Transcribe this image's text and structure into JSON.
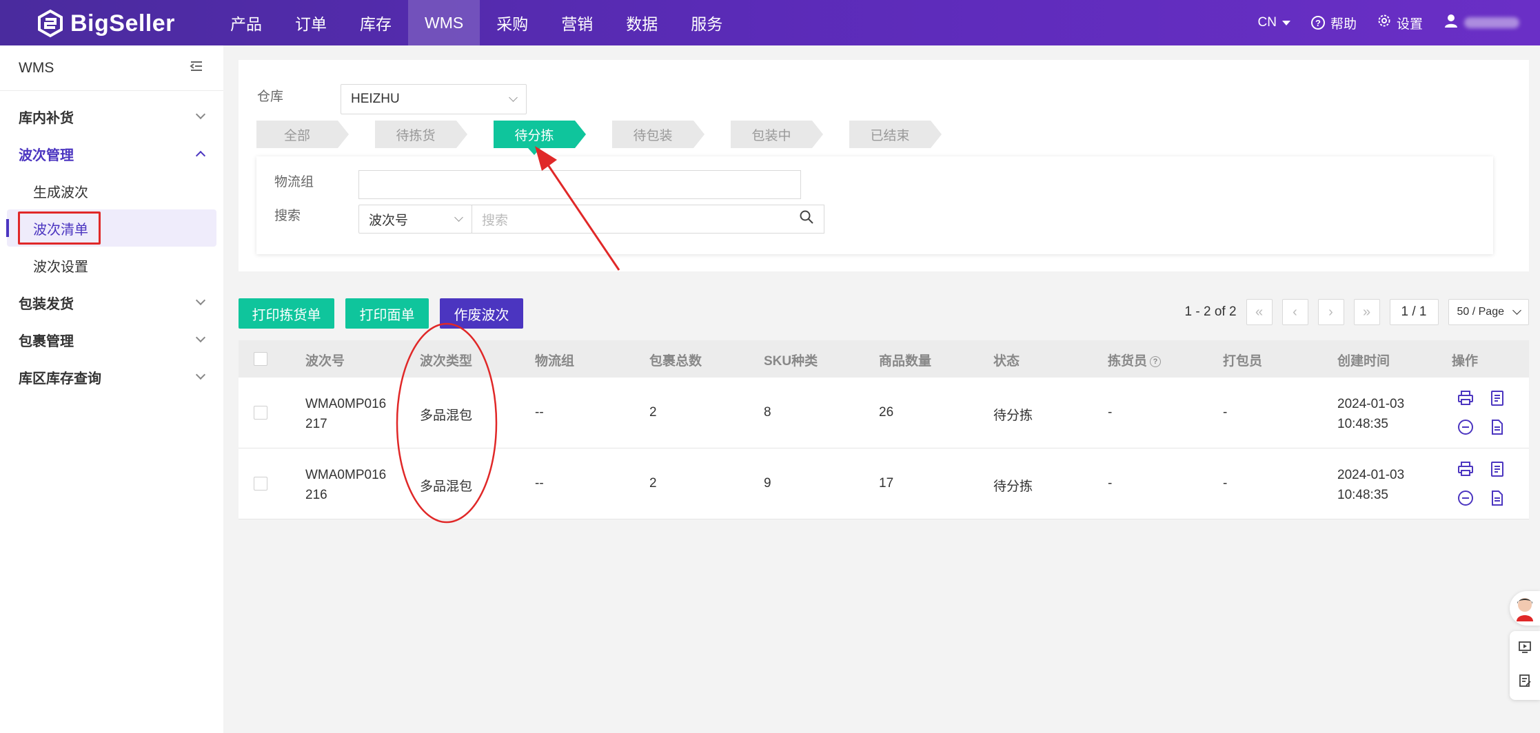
{
  "brand": {
    "name": "BigSeller"
  },
  "nav": {
    "items": [
      "产品",
      "订单",
      "库存",
      "WMS",
      "采购",
      "营销",
      "数据",
      "服务"
    ],
    "active": "WMS"
  },
  "topright": {
    "lang": "CN",
    "help": "帮助",
    "settings": "设置"
  },
  "sidebar": {
    "title": "WMS",
    "groups": [
      {
        "label": "库内补货"
      },
      {
        "label": "波次管理",
        "subs": [
          "生成波次",
          "波次清单",
          "波次设置"
        ]
      },
      {
        "label": "包装发货"
      },
      {
        "label": "包裹管理"
      },
      {
        "label": "库区库存查询"
      }
    ]
  },
  "filter": {
    "warehouse_label": "仓库",
    "warehouse_value": "HEIZHU",
    "steps": [
      "全部",
      "待拣货",
      "待分拣",
      "待包装",
      "包装中",
      "已结束"
    ],
    "active_step": "待分拣",
    "logistics_label": "物流组",
    "search_label": "搜索",
    "search_type": "波次号",
    "search_placeholder": "搜索"
  },
  "actions": {
    "print_pick": "打印拣货单",
    "print_label": "打印面单",
    "void_wave": "作废波次"
  },
  "pager": {
    "range": "1 - 2 of 2",
    "page": "1 / 1",
    "size": "50 / Page"
  },
  "table": {
    "headers": [
      "波次号",
      "波次类型",
      "物流组",
      "包裹总数",
      "SKU种类",
      "商品数量",
      "状态",
      "拣货员",
      "打包员",
      "创建时间",
      "操作"
    ],
    "rows": [
      {
        "wave_l1": "WMA0MP016",
        "wave_l2": "217",
        "type": "多品混包",
        "logistics": "--",
        "parcels": "2",
        "sku": "8",
        "qty": "26",
        "status": "待分拣",
        "picker": "-",
        "packer": "-",
        "date": "2024-01-03",
        "time": "10:48:35"
      },
      {
        "wave_l1": "WMA0MP016",
        "wave_l2": "216",
        "type": "多品混包",
        "logistics": "--",
        "parcels": "2",
        "sku": "9",
        "qty": "17",
        "status": "待分拣",
        "picker": "-",
        "packer": "-",
        "date": "2024-01-03",
        "time": "10:48:35"
      }
    ]
  },
  "colors": {
    "brand_purple": "#4b35c0",
    "green": "#0fc59c",
    "annotation_red": "#e02828"
  }
}
